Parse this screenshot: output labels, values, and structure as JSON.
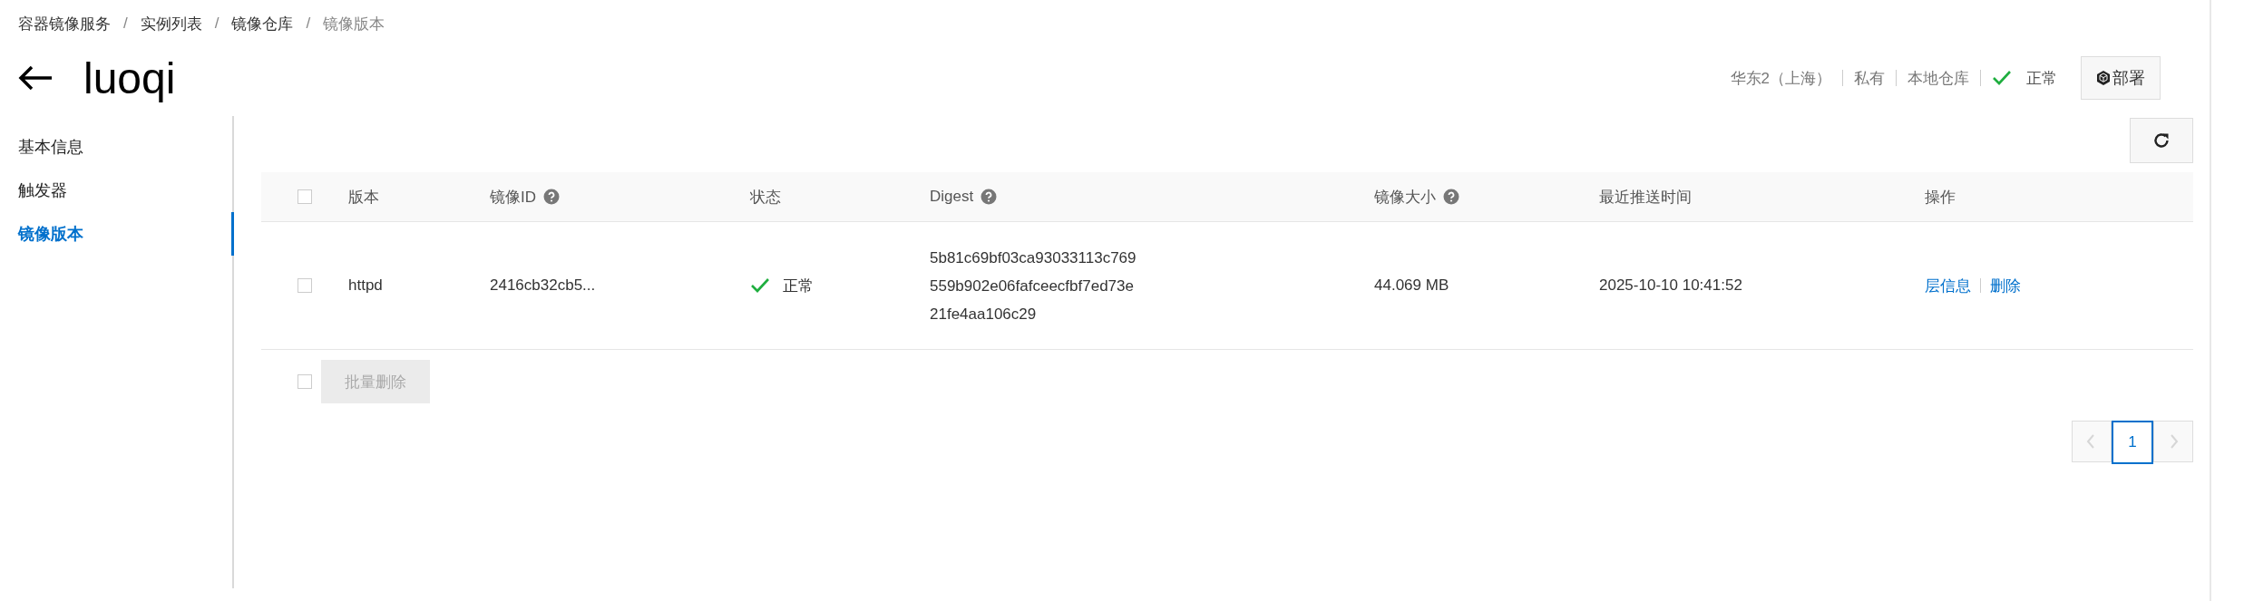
{
  "breadcrumb": [
    {
      "label": "容器镜像服务",
      "current": false
    },
    {
      "separator": "/",
      "label": "实例列表",
      "current": false
    },
    {
      "separator": "/",
      "label": "镜像仓库",
      "current": false
    },
    {
      "separator": "/",
      "label": "镜像版本",
      "current": true
    }
  ],
  "title": "luoqi",
  "info": [
    "华东2（上海）",
    "私有",
    "本地仓库"
  ],
  "status": "正常",
  "deploy_button": "部署",
  "sidebar": {
    "items": [
      {
        "label": "基本信息",
        "selected": false
      },
      {
        "label": "触发器",
        "selected": false
      },
      {
        "label": "镜像版本",
        "selected": true
      }
    ]
  },
  "table": {
    "select_all_checked": false,
    "columns": [
      {
        "label": "版本",
        "help": false
      },
      {
        "label": "镜像ID",
        "help": true
      },
      {
        "label": "状态",
        "help": false
      },
      {
        "label": "Digest",
        "help": true
      },
      {
        "label": "镜像大小",
        "help": true
      },
      {
        "label": "最近推送时间",
        "help": false
      },
      {
        "label": "操作",
        "help": false
      }
    ],
    "rows": [
      {
        "checked": false,
        "version": "httpd",
        "image_id": "2416cb32cb5...",
        "status": "正常",
        "digest": [
          "5b81c69bf03ca93033113c769",
          "559b902e06fafceecfbf7ed73e",
          "21fe4aa106c29"
        ],
        "size": "44.069 MB",
        "pushed": "2025-10-10 10:41:52",
        "actions": [
          "层信息",
          "删除"
        ]
      }
    ]
  },
  "bulk": {
    "checked": false,
    "button": "批量删除",
    "disabled": true
  },
  "pagination": {
    "pages": [
      {
        "label": "1",
        "selected": true
      }
    ],
    "prev_disabled": true,
    "next_disabled": true
  }
}
